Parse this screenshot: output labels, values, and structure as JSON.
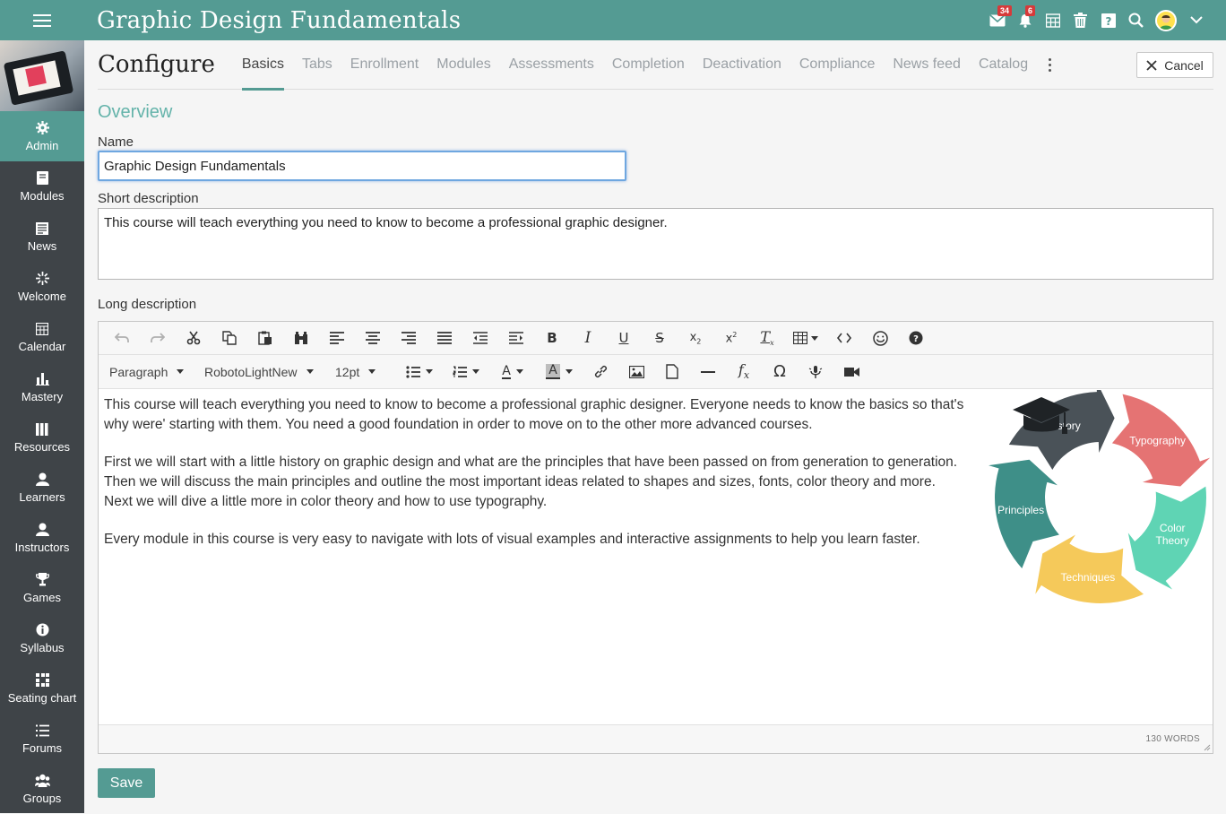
{
  "app": {
    "title": "Graphic Design Fundamentals"
  },
  "topbar": {
    "icons": [
      "mail-icon",
      "bell-icon",
      "calendar-icon",
      "trash-icon",
      "help-icon",
      "search-icon",
      "avatar",
      "chevron-down-icon"
    ],
    "mail_badge": "34",
    "bell_badge": "6"
  },
  "sidebar": {
    "items": [
      {
        "label": "Admin",
        "icon": "gear-icon",
        "active": true
      },
      {
        "label": "Modules",
        "icon": "book-icon"
      },
      {
        "label": "News",
        "icon": "news-icon"
      },
      {
        "label": "Welcome",
        "icon": "sparkle-icon"
      },
      {
        "label": "Calendar",
        "icon": "calendar-icon"
      },
      {
        "label": "Mastery",
        "icon": "bar-chart-icon"
      },
      {
        "label": "Resources",
        "icon": "resources-icon"
      },
      {
        "label": "Learners",
        "icon": "person-icon"
      },
      {
        "label": "Instructors",
        "icon": "person-icon"
      },
      {
        "label": "Games",
        "icon": "trophy-icon"
      },
      {
        "label": "Syllabus",
        "icon": "info-icon"
      },
      {
        "label": "Seating chart",
        "icon": "grid-icon"
      },
      {
        "label": "Forums",
        "icon": "list-icon"
      },
      {
        "label": "Groups",
        "icon": "group-icon"
      }
    ]
  },
  "header": {
    "title": "Configure",
    "tabs": [
      "Basics",
      "Tabs",
      "Enrollment",
      "Modules",
      "Assessments",
      "Completion",
      "Deactivation",
      "Compliance",
      "News feed",
      "Catalog"
    ],
    "active_tab": "Basics",
    "cancel_label": "Cancel"
  },
  "form": {
    "section_title": "Overview",
    "name_label": "Name",
    "name_value": "Graphic Design Fundamentals",
    "short_label": "Short description",
    "short_value": "This course will teach everything you need to know to become a professional graphic designer.",
    "long_label": "Long description",
    "save_label": "Save"
  },
  "editor": {
    "format_value": "Paragraph",
    "font_value": "RobotoLightNew",
    "size_value": "12pt",
    "paragraphs": [
      "This course will teach everything you need to know to become a professional graphic designer. Everyone needs to know the basics so that's why were' starting with them. You need a good foundation in order to move on to the other more advanced courses.",
      "First we will start with a little history on graphic design and what are the principles that have been passed on from generation to generation. Then we will discuss the main principles and outline the most important ideas related to shapes and sizes, fonts, color theory and more. Next we will dive a little more in color theory and how to use typography.",
      "Every module in this course is very easy to navigate with lots of visual examples and interactive assignments to help you learn faster."
    ],
    "word_count": "130 WORDS",
    "cycle": [
      {
        "label": "Typography",
        "color": "#e57373"
      },
      {
        "label": "Color Theory",
        "color": "#5fd4b4"
      },
      {
        "label": "Techniques",
        "color": "#f5c95a"
      },
      {
        "label": "Principles",
        "color": "#3e8f88"
      },
      {
        "label": "History",
        "color": "#4a5258"
      }
    ]
  },
  "colors": {
    "accent": "#549b93",
    "sidebar": "#3f4448",
    "overview": "#64b3aa"
  }
}
